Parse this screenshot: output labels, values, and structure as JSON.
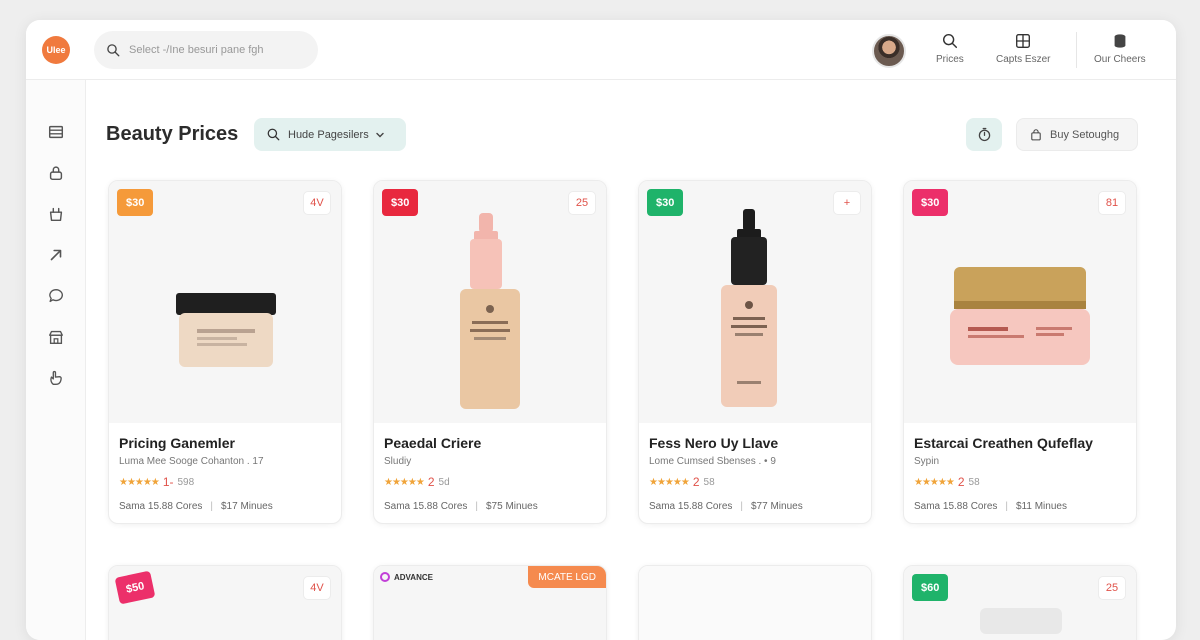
{
  "header": {
    "logo_text": "Ulee",
    "search_placeholder": "Select -/Ine besuri pane fgh",
    "nav": [
      {
        "label": "Prices",
        "icon": "search-icon"
      },
      {
        "label": "Capts Eszer",
        "icon": "grid-icon"
      },
      {
        "label": "Our Cheers",
        "icon": "cylinder-icon"
      }
    ]
  },
  "sidebar": {
    "items": [
      {
        "icon": "list-icon"
      },
      {
        "icon": "lock-icon"
      },
      {
        "icon": "basket-icon"
      },
      {
        "icon": "share-arrow-icon"
      },
      {
        "icon": "chat-icon"
      },
      {
        "icon": "store-icon"
      },
      {
        "icon": "hand-icon"
      }
    ]
  },
  "toolbar": {
    "title": "Beauty Prices",
    "filter_label": "Hude Pagesilers",
    "buy_label": "Buy Setoughg"
  },
  "products": [
    {
      "price_badge": "$30",
      "badge_color": "#f59a3a",
      "count": "4V",
      "title": "Pricing Ganemler",
      "subtitle": "Luma Mee Sooge Cohanton . 17",
      "stars": "★★★★★",
      "rating": "1-",
      "rating_extra": "598",
      "footer_left": "Sama 15.88 Cores",
      "footer_right": "$17 Minues"
    },
    {
      "price_badge": "$30",
      "badge_color": "#e8283e",
      "count": "25",
      "title": "Peaedal Criere",
      "subtitle": "Sludiy",
      "stars": "★★★★★",
      "rating": "2",
      "rating_extra": "5d",
      "footer_left": "Sama 15.88 Cores",
      "footer_right": "$75 Minues"
    },
    {
      "price_badge": "$30",
      "badge_color": "#1fb36a",
      "count": "+",
      "title": "Fess Nero Uy Llave",
      "subtitle": "Lome Cumsed Sbenses . • 9",
      "stars": "★★★★★",
      "rating": "2",
      "rating_extra": "58",
      "footer_left": "Sama 15.88 Cores",
      "footer_right": "$77 Minues"
    },
    {
      "price_badge": "$30",
      "badge_color": "#ec2f6a",
      "count": "81",
      "title": "Estarcai Creathen Qufeflay",
      "subtitle": "Sypin",
      "stars": "★★★★★",
      "rating": "2",
      "rating_extra": "58",
      "footer_left": "Sama 15.88 Cores",
      "footer_right": "$11 Minues"
    }
  ],
  "products_row2": [
    {
      "price_badge": "$50",
      "badge_color": "#ec2f6a",
      "count": "4V"
    },
    {
      "brand_tag": "ADVANCE",
      "corner_tag": "MCATE LGD",
      "corner_color": "#f58a4e"
    },
    {},
    {
      "price_badge": "$60",
      "badge_color": "#1fb36a",
      "count": "25"
    }
  ]
}
